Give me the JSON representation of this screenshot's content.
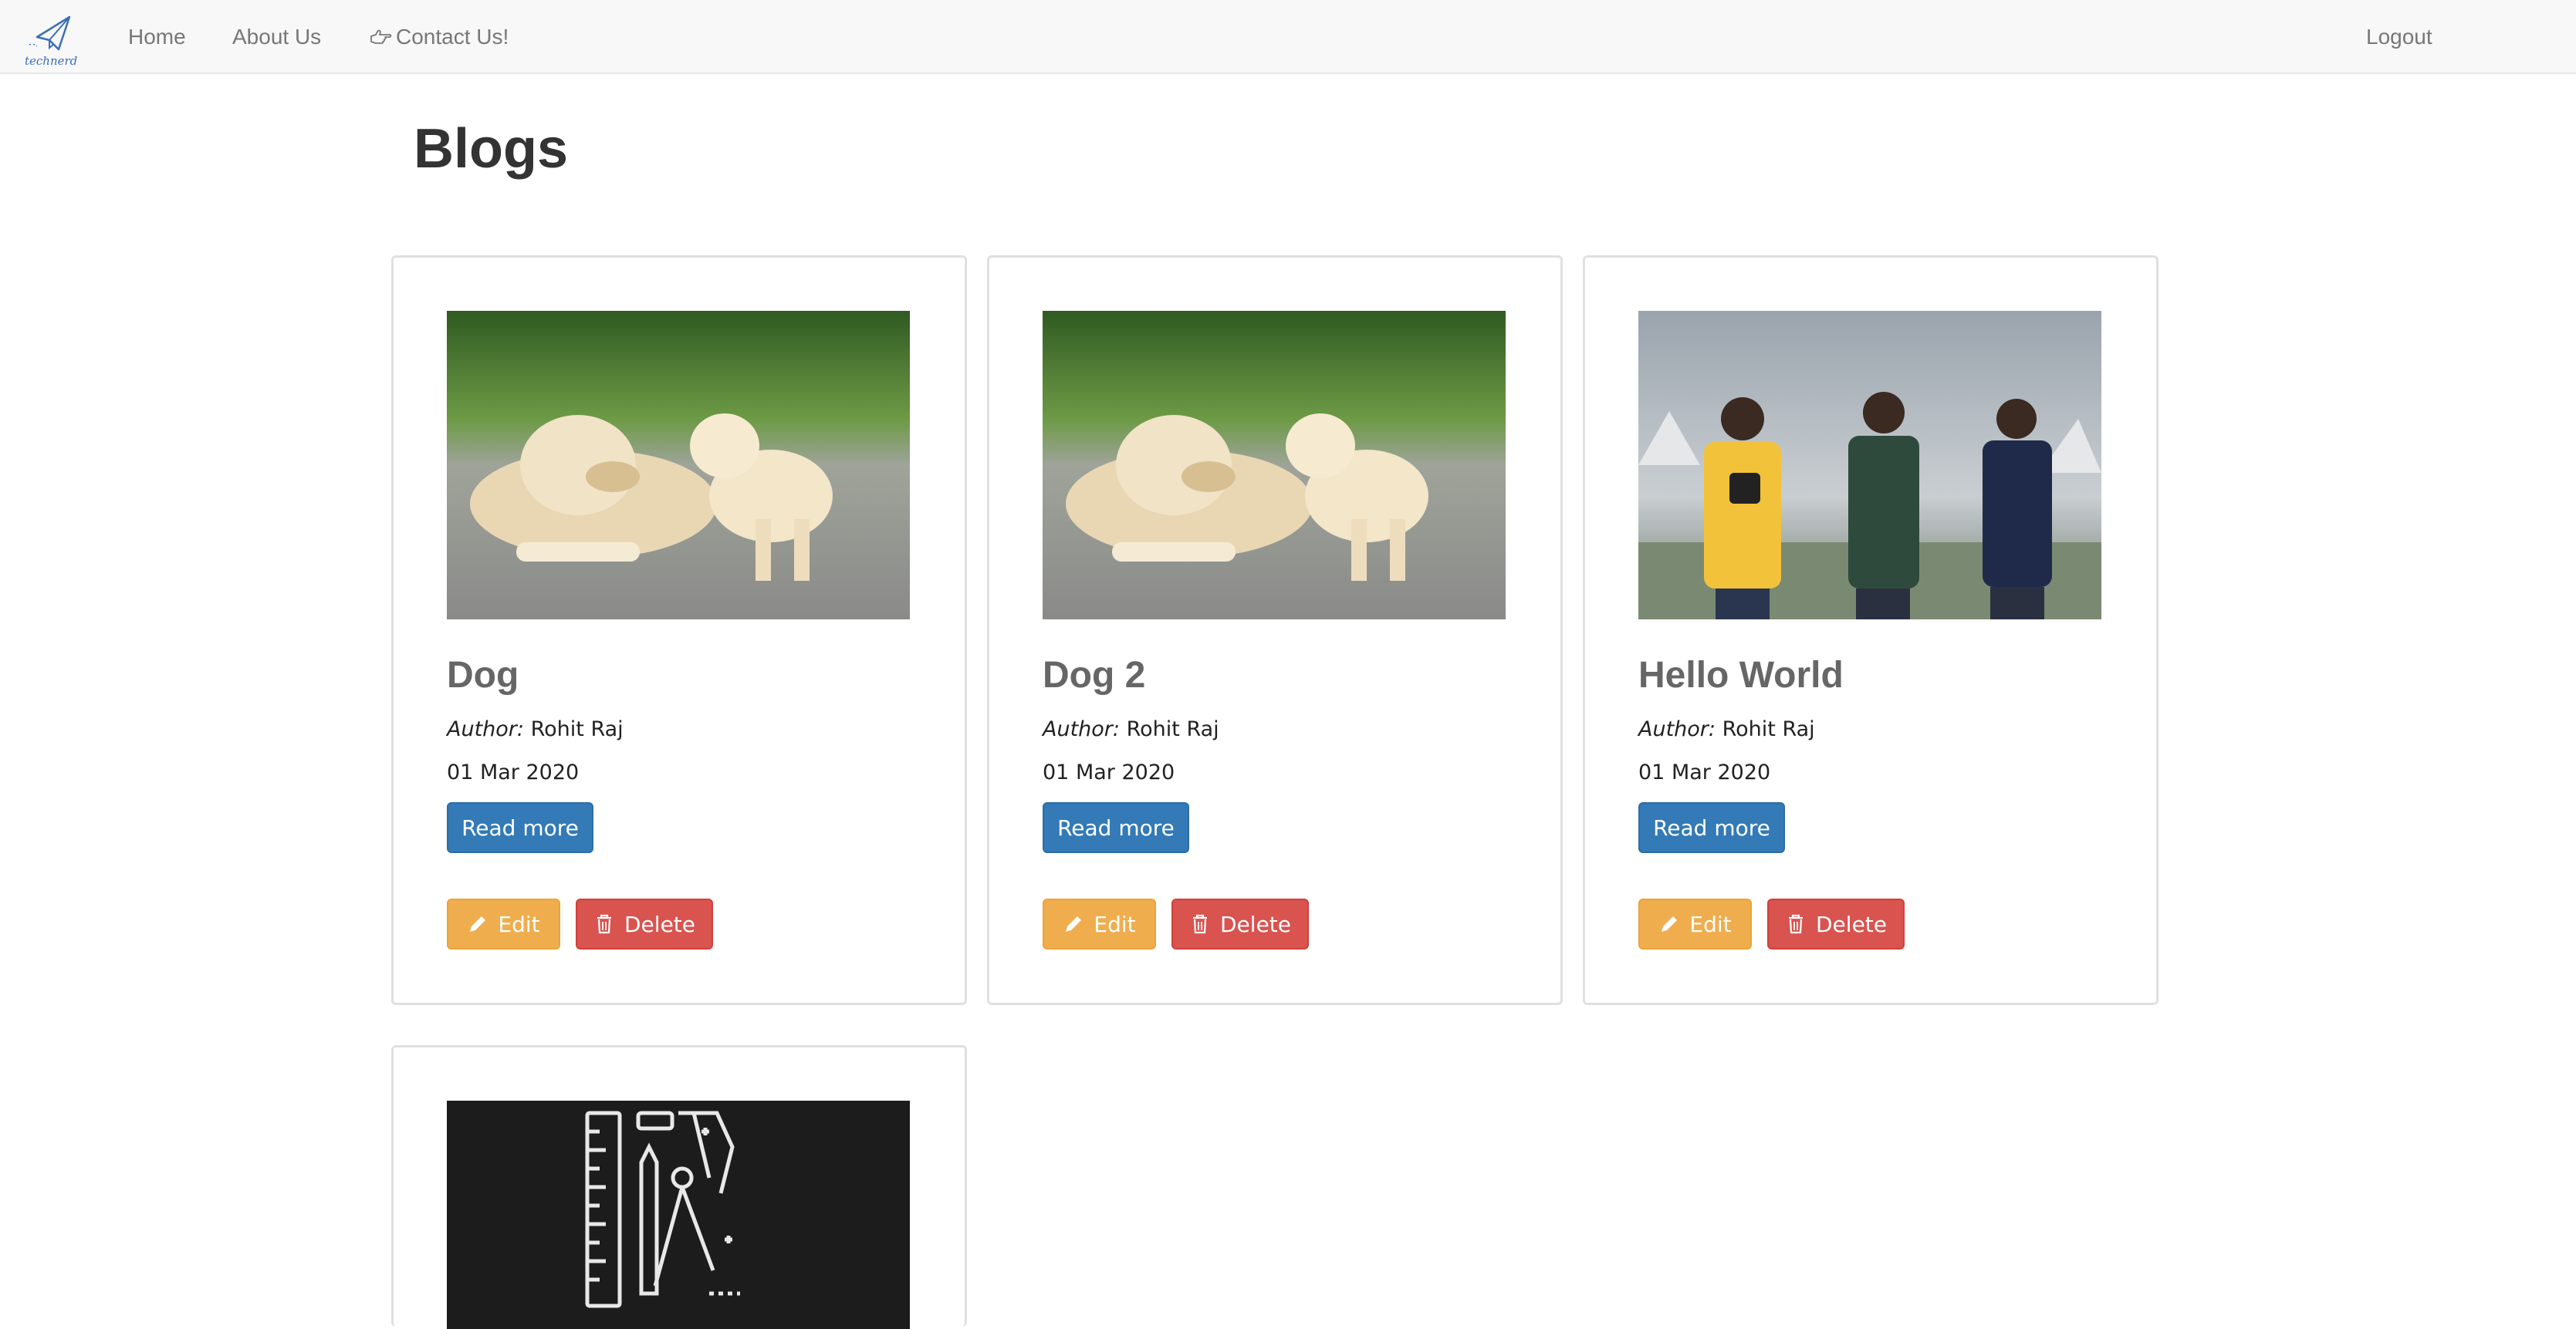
{
  "nav": {
    "brand_icon": "paper-plane-icon",
    "brand_text": "technerd",
    "home": "Home",
    "about": "About Us",
    "contact": "Contact Us!",
    "contact_icon": "hand-point-right-icon",
    "logout": "Logout"
  },
  "page": {
    "title": "Blogs"
  },
  "blogs": [
    {
      "title": "Dog",
      "author_label": "Author:",
      "author": "Rohit Raj",
      "date": "01 Mar 2020",
      "image": "dogs-photo",
      "read_more": "Read more",
      "edit": "Edit",
      "delete": "Delete"
    },
    {
      "title": "Dog 2",
      "author_label": "Author:",
      "author": "Rohit Raj",
      "date": "01 Mar 2020",
      "image": "dogs-photo",
      "read_more": "Read more",
      "edit": "Edit",
      "delete": "Delete"
    },
    {
      "title": "Hello World",
      "author_label": "Author:",
      "author": "Rohit Raj",
      "date": "01 Mar 2020",
      "image": "three-people-photo",
      "read_more": "Read more",
      "edit": "Edit",
      "delete": "Delete"
    },
    {
      "image": "tools-icon-image"
    }
  ],
  "colors": {
    "navbar_bg": "#f8f8f8",
    "primary": "#337ab7",
    "warning": "#f0ad4e",
    "danger": "#d9534f"
  }
}
